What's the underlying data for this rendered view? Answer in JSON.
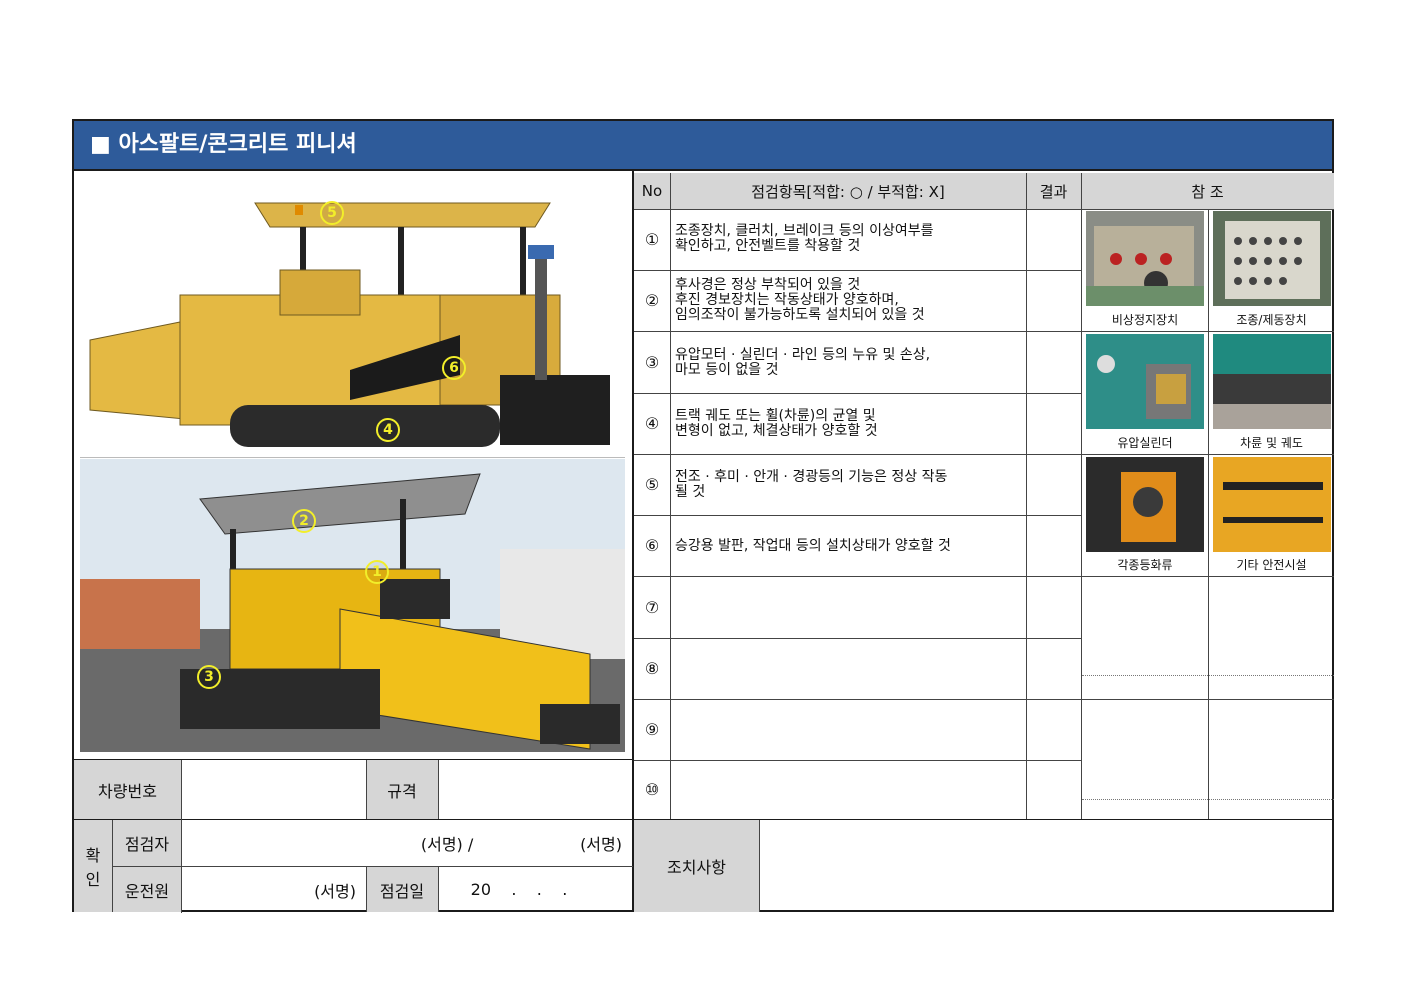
{
  "title": "■ 아스팔트/콘크리트 피니셔",
  "table_header": {
    "no": "No",
    "item": "점검항목[적합: ○ / 부적합: X]",
    "result": "결과",
    "reference": "참 조"
  },
  "items": [
    {
      "no": "①",
      "text": "조종장치, 클러치, 브레이크 등의 이상여부를\n확인하고, 안전벨트를 착용할 것"
    },
    {
      "no": "②",
      "text": "후사경은 정상 부착되어 있을 것\n후진 경보장치는 작동상태가 양호하며,\n임의조작이 불가능하도록 설치되어 있을 것"
    },
    {
      "no": "③",
      "text": "유압모터 · 실린더 · 라인 등의 누유 및 손상,\n마모 등이 없을 것"
    },
    {
      "no": "④",
      "text": "트랙 궤도 또는 휠(차륜)의 균열 및\n변형이 없고, 체결상태가 양호할 것"
    },
    {
      "no": "⑤",
      "text": "전조 · 후미 · 안개 · 경광등의 기능은 정상 작동\n될 것"
    },
    {
      "no": "⑥",
      "text": "승강용 발판, 작업대 등의 설치상태가 양호할 것"
    },
    {
      "no": "⑦",
      "text": ""
    },
    {
      "no": "⑧",
      "text": ""
    },
    {
      "no": "⑨",
      "text": ""
    },
    {
      "no": "⑩",
      "text": ""
    }
  ],
  "reference_captions": [
    "비상정지장치",
    "조종/제동장치",
    "유압실린더",
    "차륜 및 궤도",
    "각종등화류",
    "기타 안전시설"
  ],
  "markers": [
    "5",
    "6",
    "4",
    "2",
    "1",
    "3"
  ],
  "form": {
    "vehicle_no_label": "차량번호",
    "spec_label": "규격",
    "confirm_label": "확\n인",
    "inspector_label": "점검자",
    "inspector_sign": "(서명) /                     (서명)",
    "driver_label": "운전원",
    "driver_sign": "(서명)",
    "date_label": "점검일",
    "date_value": "20    .    .    .",
    "action_label": "조치사항"
  },
  "colors": {
    "title_bar": "#2e5b9a",
    "header_gray": "#d6d6d6",
    "marker": "#f2ee2a",
    "machine_yellow": "#e4b943"
  }
}
